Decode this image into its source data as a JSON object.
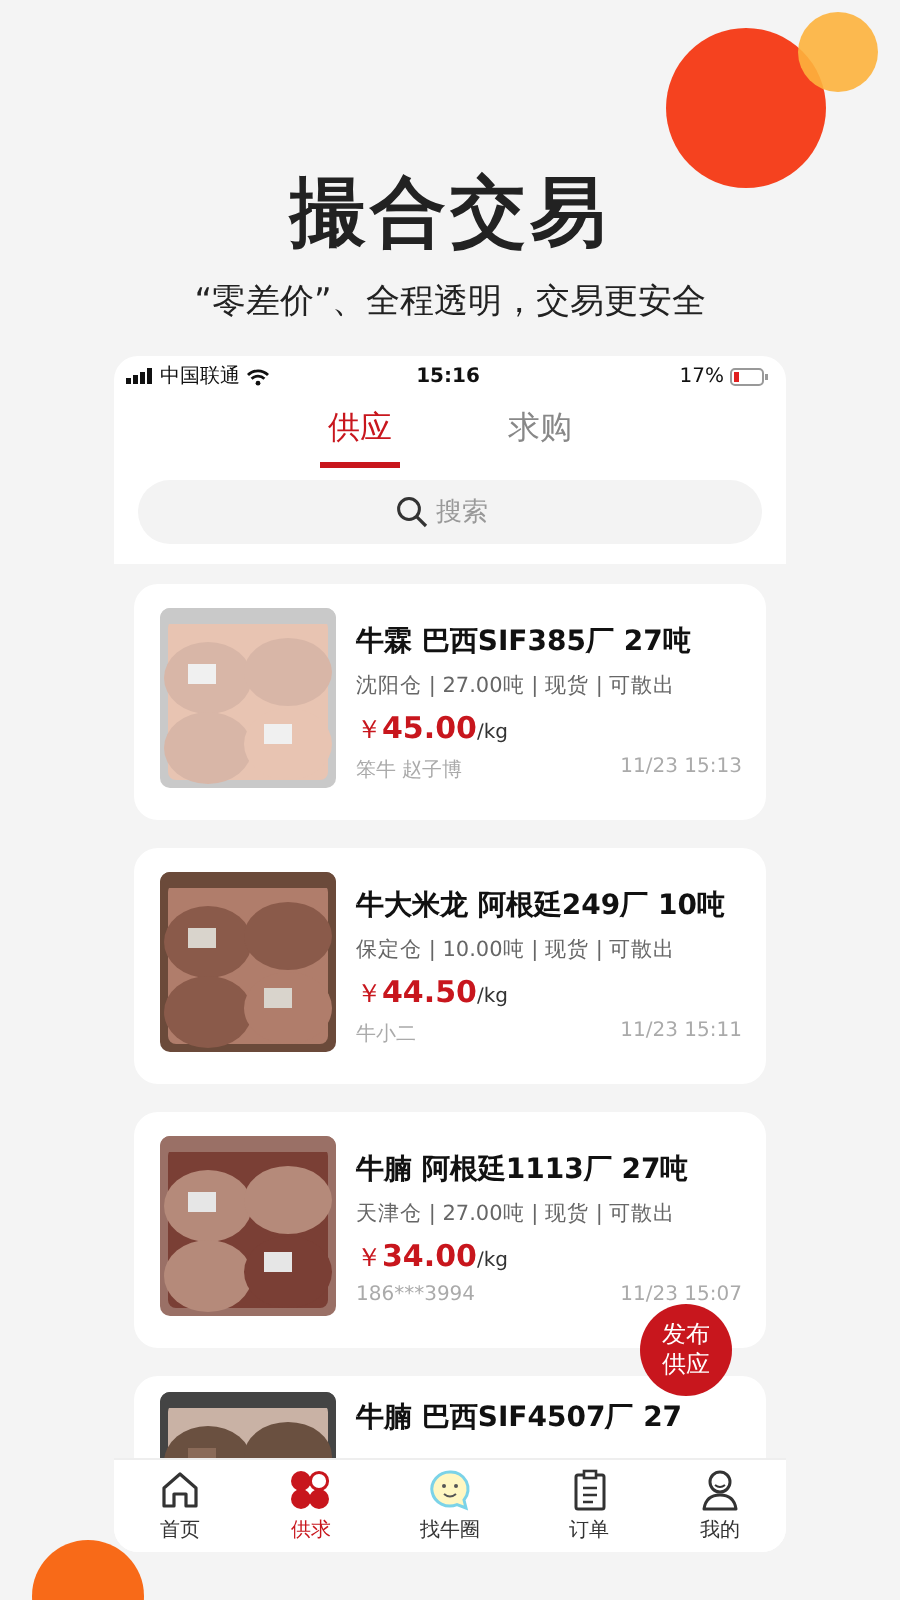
{
  "headline": "撮合交易",
  "subheadline": "“零差价”、全程透明，交易更安全",
  "status_bar": {
    "carrier": "中国联通",
    "time": "15:16",
    "battery": "17%"
  },
  "tabs": [
    {
      "label": "供应",
      "selected": true
    },
    {
      "label": "求购",
      "selected": false
    }
  ],
  "search": {
    "placeholder": "搜索"
  },
  "listings": [
    {
      "title": "牛霖 巴西SIF385厂 27吨",
      "details": "沈阳仓 | 27.00吨 | 现货 | 可散出",
      "currency": "￥",
      "price": "45.00",
      "unit": "/kg",
      "seller": "笨牛 赵子博",
      "time": "11/23 15:13"
    },
    {
      "title": "牛大米龙 阿根廷249厂 10吨",
      "details": "保定仓 | 10.00吨 | 现货 | 可散出",
      "currency": "￥",
      "price": "44.50",
      "unit": "/kg",
      "seller": "牛小二",
      "time": "11/23 15:11"
    },
    {
      "title": "牛腩 阿根廷1113厂 27吨",
      "details": "天津仓 | 27.00吨 | 现货 | 可散出",
      "currency": "￥",
      "price": "34.00",
      "unit": "/kg",
      "seller": "186***3994",
      "time": "11/23 15:07"
    },
    {
      "title": "牛腩 巴西SIF4507厂 27"
    }
  ],
  "fab": {
    "label": "发布供应"
  },
  "nav": [
    {
      "label": "首页",
      "kind": "home",
      "selected": false
    },
    {
      "label": "供求",
      "kind": "clover",
      "selected": true
    },
    {
      "label": "找牛圈",
      "kind": "chat",
      "selected": false
    },
    {
      "label": "订单",
      "kind": "clipboard",
      "selected": false
    },
    {
      "label": "我的",
      "kind": "person",
      "selected": false
    }
  ]
}
